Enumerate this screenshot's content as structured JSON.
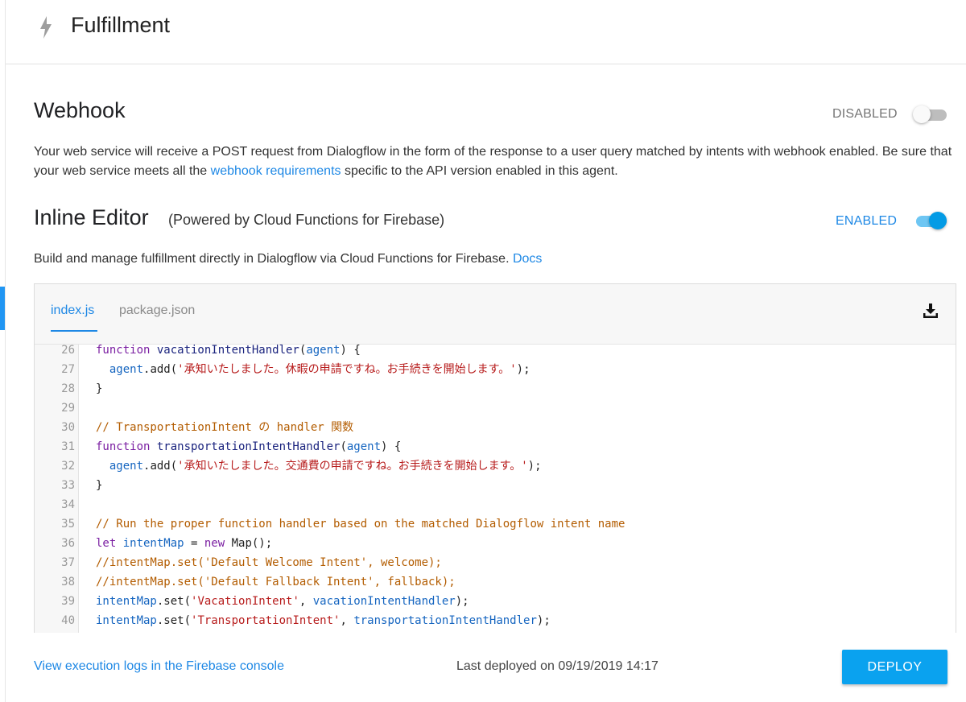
{
  "header": {
    "title": "Fulfillment",
    "icon": "bolt-icon"
  },
  "webhook": {
    "title": "Webhook",
    "status_label": "DISABLED",
    "enabled": false,
    "description_part1": "Your web service will receive a POST request from Dialogflow in the form of the response to a user query matched by intents with webhook enabled. Be sure that your web service meets all the ",
    "requirements_link": "webhook requirements",
    "description_part2": " specific to the API version enabled in this agent."
  },
  "inline_editor": {
    "title": "Inline Editor",
    "subtitle": "(Powered by Cloud Functions for Firebase)",
    "status_label": "ENABLED",
    "enabled": true,
    "description": "Build and manage fulfillment directly in Dialogflow via Cloud Functions for Firebase. ",
    "docs_link": "Docs"
  },
  "editor": {
    "tabs": [
      {
        "label": "index.js",
        "active": true
      },
      {
        "label": "package.json",
        "active": false
      }
    ],
    "download_icon": "download-icon",
    "lines": [
      {
        "num": "26",
        "tokens": [
          {
            "t": "function ",
            "c": "kw"
          },
          {
            "t": "vacationIntentHandler",
            "c": "fn"
          },
          {
            "t": "(",
            "c": ""
          },
          {
            "t": "agent",
            "c": "vr"
          },
          {
            "t": ") {",
            "c": ""
          }
        ]
      },
      {
        "num": "27",
        "tokens": [
          {
            "t": "  ",
            "c": ""
          },
          {
            "t": "agent",
            "c": "vr"
          },
          {
            "t": ".add(",
            "c": ""
          },
          {
            "t": "'承知いたしました。休暇の申請ですね。お手続きを開始します。'",
            "c": "st"
          },
          {
            "t": ");",
            "c": ""
          }
        ]
      },
      {
        "num": "28",
        "tokens": [
          {
            "t": "}",
            "c": ""
          }
        ]
      },
      {
        "num": "29",
        "tokens": []
      },
      {
        "num": "30",
        "tokens": [
          {
            "t": "// TransportationIntent の handler 関数",
            "c": "cm"
          }
        ]
      },
      {
        "num": "31",
        "tokens": [
          {
            "t": "function ",
            "c": "kw"
          },
          {
            "t": "transportationIntentHandler",
            "c": "fn"
          },
          {
            "t": "(",
            "c": ""
          },
          {
            "t": "agent",
            "c": "vr"
          },
          {
            "t": ") {",
            "c": ""
          }
        ]
      },
      {
        "num": "32",
        "tokens": [
          {
            "t": "  ",
            "c": ""
          },
          {
            "t": "agent",
            "c": "vr"
          },
          {
            "t": ".add(",
            "c": ""
          },
          {
            "t": "'承知いたしました。交通費の申請ですね。お手続きを開始します。'",
            "c": "st"
          },
          {
            "t": ");",
            "c": ""
          }
        ]
      },
      {
        "num": "33",
        "tokens": [
          {
            "t": "}",
            "c": ""
          }
        ]
      },
      {
        "num": "34",
        "tokens": []
      },
      {
        "num": "35",
        "tokens": [
          {
            "t": "// Run the proper function handler based on the matched Dialogflow intent name",
            "c": "cm"
          }
        ]
      },
      {
        "num": "36",
        "tokens": [
          {
            "t": "let ",
            "c": "kw"
          },
          {
            "t": "intentMap",
            "c": "vr"
          },
          {
            "t": " = ",
            "c": ""
          },
          {
            "t": "new ",
            "c": "kw"
          },
          {
            "t": "Map();",
            "c": ""
          }
        ]
      },
      {
        "num": "37",
        "tokens": [
          {
            "t": "//intentMap.set('Default Welcome Intent', welcome);",
            "c": "cm"
          }
        ]
      },
      {
        "num": "38",
        "tokens": [
          {
            "t": "//intentMap.set('Default Fallback Intent', fallback);",
            "c": "cm"
          }
        ]
      },
      {
        "num": "39",
        "tokens": [
          {
            "t": "intentMap",
            "c": "vr"
          },
          {
            "t": ".set(",
            "c": ""
          },
          {
            "t": "'VacationIntent'",
            "c": "st"
          },
          {
            "t": ", ",
            "c": ""
          },
          {
            "t": "vacationIntentHandler",
            "c": "vr"
          },
          {
            "t": ");",
            "c": ""
          }
        ]
      },
      {
        "num": "40",
        "tokens": [
          {
            "t": "intentMap",
            "c": "vr"
          },
          {
            "t": ".set(",
            "c": ""
          },
          {
            "t": "'TransportationIntent'",
            "c": "st"
          },
          {
            "t": ", ",
            "c": ""
          },
          {
            "t": "transportationIntentHandler",
            "c": "vr"
          },
          {
            "t": ");",
            "c": ""
          }
        ]
      }
    ]
  },
  "footer": {
    "logs_link": "View execution logs in the Firebase console",
    "last_deployed": "Last deployed on 09/19/2019 14:17",
    "deploy_label": "DEPLOY"
  },
  "colors": {
    "accent": "#1e88e5",
    "deploy_button": "#0aa2ef",
    "toggle_on_thumb": "#039be5",
    "toggle_on_track": "#6ec6f3",
    "toggle_off_thumb": "#fafafa",
    "toggle_off_track": "#bdbdbd"
  }
}
